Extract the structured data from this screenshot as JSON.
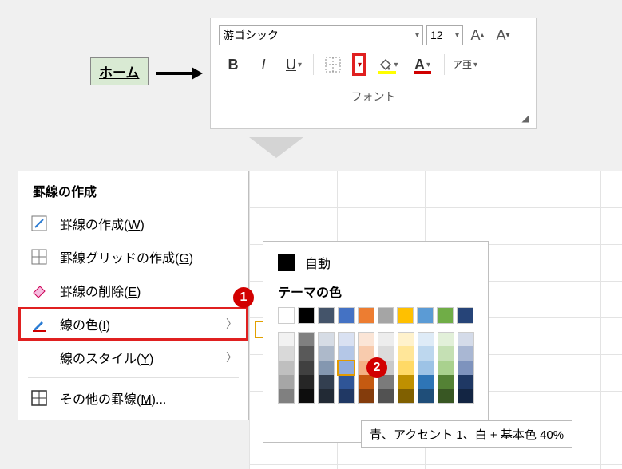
{
  "ribbon": {
    "font_name": "游ゴシック",
    "font_size": "12",
    "bold": "B",
    "italic": "I",
    "underline": "U",
    "ruby": "ア亜",
    "group_label": "フォント"
  },
  "home_tab": {
    "label": "ホーム"
  },
  "context_menu": {
    "header": "罫線の作成",
    "items": [
      {
        "label_pre": "罫線の作成(",
        "accel": "W",
        "label_post": ")",
        "icon": "draw-border-icon",
        "sub": false
      },
      {
        "label_pre": "罫線グリッドの作成(",
        "accel": "G",
        "label_post": ")",
        "icon": "draw-grid-icon",
        "sub": false
      },
      {
        "label_pre": "罫線の削除(",
        "accel": "E",
        "label_post": ")",
        "icon": "eraser-icon",
        "sub": false
      },
      {
        "label_pre": "線の色(",
        "accel": "I",
        "label_post": ")",
        "icon": "pen-color-icon",
        "sub": true,
        "highlight": true
      },
      {
        "label_pre": "線のスタイル(",
        "accel": "Y",
        "label_post": ")",
        "icon": "",
        "sub": true
      },
      {
        "label_pre": "その他の罫線(",
        "accel": "M",
        "label_post": ")...",
        "icon": "borders-more-icon",
        "sub": false
      }
    ]
  },
  "color_flyout": {
    "auto_label": "自動",
    "theme_title": "テーマの色",
    "theme_row": [
      "#ffffff",
      "#000000",
      "#44546a",
      "#4472c4",
      "#ed7d31",
      "#a5a5a5",
      "#ffc000",
      "#5b9bd5",
      "#70ad47",
      "#264478"
    ],
    "shade_columns": [
      [
        "#f2f2f2",
        "#d9d9d9",
        "#bfbfbf",
        "#a6a6a6",
        "#808080"
      ],
      [
        "#808080",
        "#595959",
        "#404040",
        "#262626",
        "#0d0d0d"
      ],
      [
        "#d6dce5",
        "#adb9ca",
        "#8497b0",
        "#333f50",
        "#222a35"
      ],
      [
        "#d9e1f2",
        "#b4c7e7",
        "#8faadc",
        "#2f5597",
        "#203864"
      ],
      [
        "#fbe5d6",
        "#f8cbad",
        "#f4b183",
        "#c55a11",
        "#843c0c"
      ],
      [
        "#ededed",
        "#dbdbdb",
        "#c9c9c9",
        "#7b7b7b",
        "#525252"
      ],
      [
        "#fff2cc",
        "#ffe699",
        "#ffd966",
        "#bf9000",
        "#806000"
      ],
      [
        "#deebf7",
        "#bdd7ee",
        "#9dc3e6",
        "#2e75b6",
        "#1f4e79"
      ],
      [
        "#e2f0d9",
        "#c5e0b4",
        "#a9d18e",
        "#548235",
        "#385723"
      ],
      [
        "#d4dbe9",
        "#a9b7d3",
        "#7e93bd",
        "#1f3864",
        "#132543"
      ]
    ],
    "selected": {
      "col": 3,
      "row": 2
    }
  },
  "tooltip": {
    "text": "青、アクセント 1、白 + 基本色 40%"
  },
  "badges": {
    "one": "1",
    "two": "2"
  }
}
